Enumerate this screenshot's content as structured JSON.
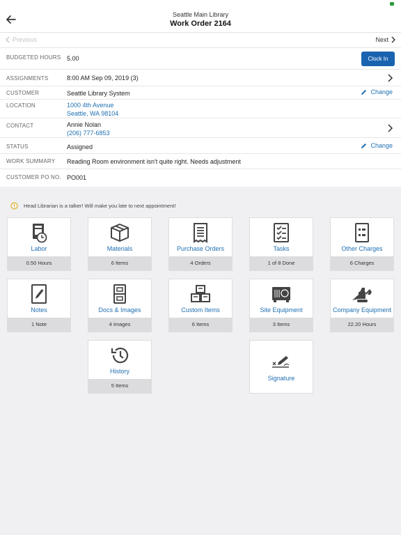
{
  "header": {
    "subtitle": "Seattle Main Library",
    "title": "Work Order 2164",
    "prev_label": "Previous",
    "next_label": "Next"
  },
  "details": {
    "budgeted_hours": {
      "label": "BUDGETED HOURS",
      "value": "5.00",
      "action": "Clock In"
    },
    "assignments": {
      "label": "ASSIGNMENTS",
      "value": "8:00 AM Sep 09, 2019  (3)"
    },
    "customer": {
      "label": "CUSTOMER",
      "value": "Seattle Library System",
      "action": "Change"
    },
    "location": {
      "label": "LOCATION",
      "line1": "1000 4th Avenue",
      "line2": "Seattle, WA 98104"
    },
    "contact": {
      "label": "CONTACT",
      "name": "Annie Nolan",
      "phone": "(206) 777-6853"
    },
    "status": {
      "label": "STATUS",
      "value": "Assigned",
      "action": "Change"
    },
    "work_summary": {
      "label": "WORK SUMMARY",
      "value": "Reading Room environment isn't quite right.  Needs adjustment"
    },
    "customer_po": {
      "label": "CUSTOMER PO NO.",
      "value": "PO001"
    }
  },
  "alert": {
    "text": "Head Librarian is a talker!  Will make you late to next appointment!",
    "color": "#e0a800"
  },
  "accent": "#1f6fb2",
  "tiles": [
    {
      "label": "Labor",
      "footer": "0.50 Hours",
      "icon": "labor-clock-icon"
    },
    {
      "label": "Materials",
      "footer": "6 Items",
      "icon": "box-icon"
    },
    {
      "label": "Purchase Orders",
      "footer": "4 Orders",
      "icon": "receipt-icon"
    },
    {
      "label": "Tasks",
      "footer": "1 of 8 Done",
      "icon": "checklist-icon"
    },
    {
      "label": "Other Charges",
      "footer": "6 Charges",
      "icon": "list-icon"
    },
    {
      "label": "Notes",
      "footer": "1 Note",
      "icon": "pencil-note-icon"
    },
    {
      "label": "Docs & Images",
      "footer": "4 Images",
      "icon": "file-cabinet-icon"
    },
    {
      "label": "Custom Items",
      "footer": "6 Items",
      "icon": "stacked-boxes-icon"
    },
    {
      "label": "Site Equipment",
      "footer": "3 Items",
      "icon": "hvac-unit-icon"
    },
    {
      "label": "Company Equipment",
      "footer": "22.20 Hours",
      "icon": "excavator-icon"
    },
    {
      "label": "History",
      "footer": "5 Items",
      "icon": "history-icon"
    },
    {
      "label": "Signature",
      "icon": "signature-icon"
    }
  ]
}
